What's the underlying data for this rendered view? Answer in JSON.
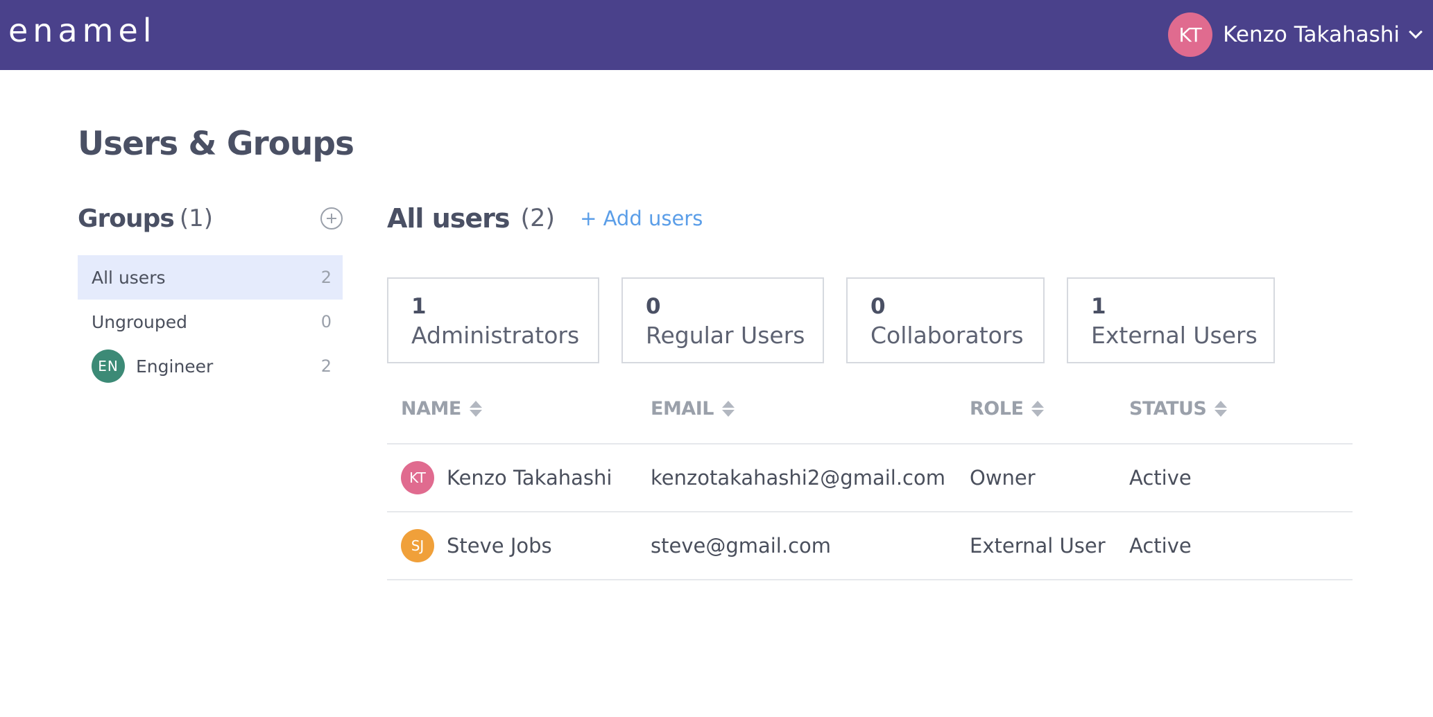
{
  "app": {
    "logo": "enamel"
  },
  "user": {
    "initials": "KT",
    "name": "Kenzo Takahashi",
    "avatar_color": "#e06b8f"
  },
  "page": {
    "title": "Users & Groups"
  },
  "groups": {
    "title": "Groups",
    "count": "(1)",
    "items": [
      {
        "label": "All users",
        "count": "2"
      },
      {
        "label": "Ungrouped",
        "count": "0"
      },
      {
        "initials": "EN",
        "label": "Engineer",
        "count": "2",
        "avatar_color": "#3c8a76"
      }
    ]
  },
  "main": {
    "title": "All users",
    "count": "(2)",
    "add_users": "+ Add users"
  },
  "stats": [
    {
      "value": "1",
      "label": "Administrators"
    },
    {
      "value": "0",
      "label": "Regular Users"
    },
    {
      "value": "0",
      "label": "Collaborators"
    },
    {
      "value": "1",
      "label": "External Users"
    }
  ],
  "table": {
    "headers": [
      "NAME",
      "EMAIL",
      "ROLE",
      "STATUS"
    ],
    "rows": [
      {
        "initials": "KT",
        "name": "Kenzo Takahashi",
        "email": "kenzotakahashi2@gmail.com",
        "role": "Owner",
        "status": "Active",
        "avatar_color": "#e06b8f"
      },
      {
        "initials": "SJ",
        "name": "Steve Jobs",
        "email": "steve@gmail.com",
        "role": "External User",
        "status": "Active",
        "avatar_color": "#f0a03a"
      }
    ]
  },
  "colors": {
    "topbar": "#4a418b",
    "accent": "#5b9ee8",
    "active_group_bg": "#e5ebfc"
  }
}
